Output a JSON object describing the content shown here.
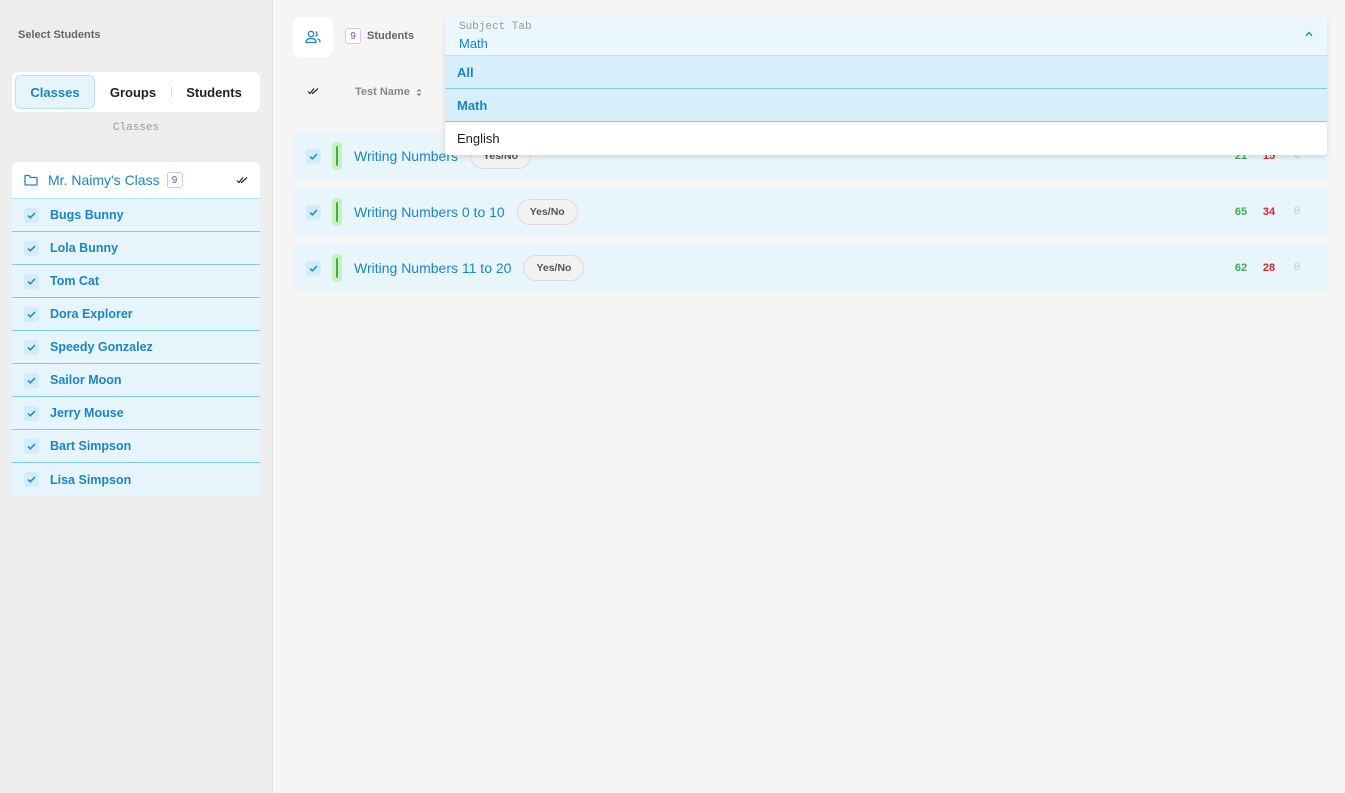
{
  "sidebar": {
    "title": "Select Students",
    "tabs": [
      {
        "label": "Classes",
        "active": true
      },
      {
        "label": "Groups",
        "active": false
      },
      {
        "label": "Students",
        "active": false
      }
    ],
    "caption": "Classes",
    "class": {
      "name": "Mr. Naimy's Class",
      "count": "9"
    },
    "students": [
      "Bugs Bunny",
      "Lola Bunny",
      "Tom Cat",
      "Dora Explorer",
      "Speedy Gonzalez",
      "Sailor Moon",
      "Jerry Mouse",
      "Bart Simpson",
      "Lisa Simpson"
    ]
  },
  "main": {
    "students_count": "9",
    "students_label": "Students",
    "column_test_name": "Test Name",
    "tests": [
      {
        "name": "Writing Numbers",
        "type": "Yes/No",
        "stats": [
          "21",
          "15",
          "0"
        ]
      },
      {
        "name": "Writing Numbers 0 to 10",
        "type": "Yes/No",
        "stats": [
          "65",
          "34",
          "0"
        ]
      },
      {
        "name": "Writing Numbers 11 to 20",
        "type": "Yes/No",
        "stats": [
          "62",
          "28",
          "0"
        ]
      }
    ]
  },
  "subject_dropdown": {
    "label": "Subject Tab",
    "value": "Math",
    "options": [
      "All",
      "Math",
      "English"
    ]
  },
  "colors": {
    "accent": "#1a86c4",
    "selected_bg": "#e6f5fc",
    "green": "#3faa55",
    "red": "#d42a2a"
  }
}
